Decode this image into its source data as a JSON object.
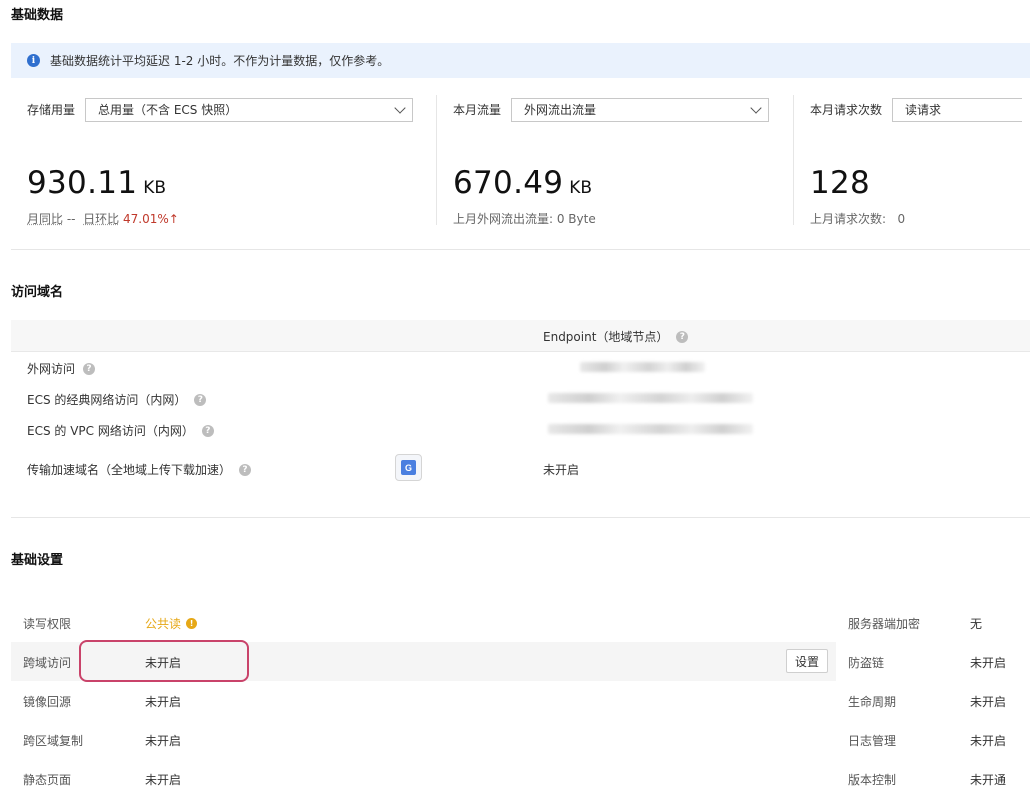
{
  "sections": {
    "basic_data": "基础数据",
    "access_domain": "访问域名",
    "basic_settings": "基础设置"
  },
  "info": {
    "icon": "info-icon",
    "text": "基础数据统计平均延迟 1-2 小时。不作为计量数据，仅作参考。"
  },
  "metrics": {
    "storage": {
      "label": "存储用量",
      "select": "总用量（不含 ECS 快照）",
      "value": "930.11",
      "unit": "KB",
      "sub_mom": "月同比",
      "sub_sep": "--",
      "sub_dod": "日环比",
      "sub_pct": "47.01%",
      "sub_arrow": "↑"
    },
    "traffic": {
      "label": "本月流量",
      "select": "外网流出流量",
      "value": "670.49",
      "unit": "KB",
      "sub": "上月外网流出流量: 0 Byte"
    },
    "requests": {
      "label": "本月请求次数",
      "select": "读请求",
      "value": "128",
      "sub_label": "上月请求次数:",
      "sub_value": "0"
    }
  },
  "endpoint": {
    "header": "Endpoint（地域节点）",
    "rows": [
      {
        "label": "外网访问"
      },
      {
        "label": "ECS 的经典网络访问（内网）"
      },
      {
        "label": "ECS 的 VPC 网络访问（内网）"
      },
      {
        "label": "传输加速域名（全地域上传下载加速）",
        "value": "未开启"
      }
    ]
  },
  "settings": {
    "left": [
      {
        "label": "读写权限",
        "value": "公共读"
      },
      {
        "label": "跨域访问",
        "value": "未开启",
        "button": "设置"
      },
      {
        "label": "镜像回源",
        "value": "未开启"
      },
      {
        "label": "跨区域复制",
        "value": "未开启"
      },
      {
        "label": "静态页面",
        "value": "未开启"
      }
    ],
    "right": [
      {
        "label": "服务器端加密",
        "value": "无"
      },
      {
        "label": "防盗链",
        "value": "未开启"
      },
      {
        "label": "生命周期",
        "value": "未开启"
      },
      {
        "label": "日志管理",
        "value": "未开启"
      },
      {
        "label": "版本控制",
        "value": "未开通"
      }
    ]
  },
  "colors": {
    "accent_blue": "#2f6fce",
    "info_bg": "#eaf2fd",
    "warning": "#e6a817",
    "increase_red": "#c0392b",
    "highlight_border": "#c9436a"
  }
}
